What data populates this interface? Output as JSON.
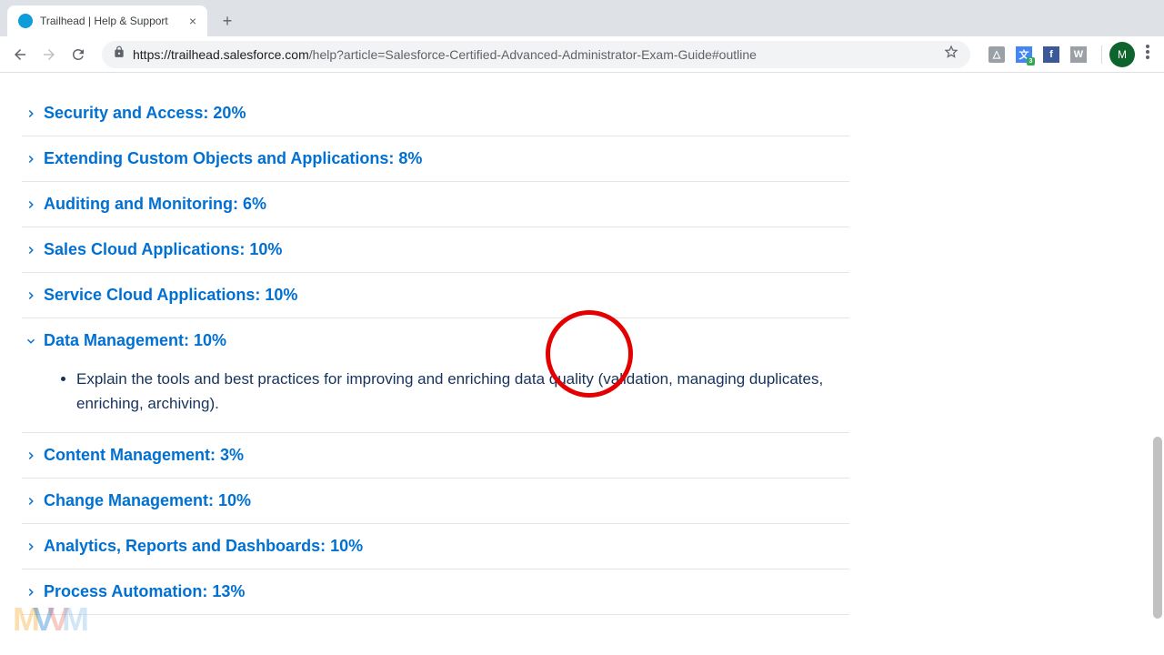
{
  "browser": {
    "tab_title": "Trailhead | Help & Support",
    "url_domain": "https://trailhead.salesforce.com",
    "url_path": "/help?article=Salesforce-Certified-Advanced-Administrator-Exam-Guide#outline",
    "avatar_letter": "M"
  },
  "outline": [
    {
      "title": "Security and Access: 20%",
      "expanded": false
    },
    {
      "title": "Extending Custom Objects and Applications: 8%",
      "expanded": false
    },
    {
      "title": "Auditing and Monitoring: 6%",
      "expanded": false
    },
    {
      "title": "Sales Cloud Applications: 10%",
      "expanded": false
    },
    {
      "title": "Service Cloud Applications: 10%",
      "expanded": false
    },
    {
      "title": "Data Management: 10%",
      "expanded": true,
      "bullets": [
        "Explain the tools and best practices for improving and enriching data quality (validation, managing duplicates, enriching, archiving)."
      ]
    },
    {
      "title": "Content Management: 3%",
      "expanded": false
    },
    {
      "title": "Change Management: 10%",
      "expanded": false
    },
    {
      "title": "Analytics, Reports and Dashboards: 10%",
      "expanded": false
    },
    {
      "title": "Process Automation: 13%",
      "expanded": false
    }
  ],
  "watermark_colors": [
    "#f5a623",
    "#0070d2",
    "#e86c60",
    "#7fb9e8"
  ]
}
